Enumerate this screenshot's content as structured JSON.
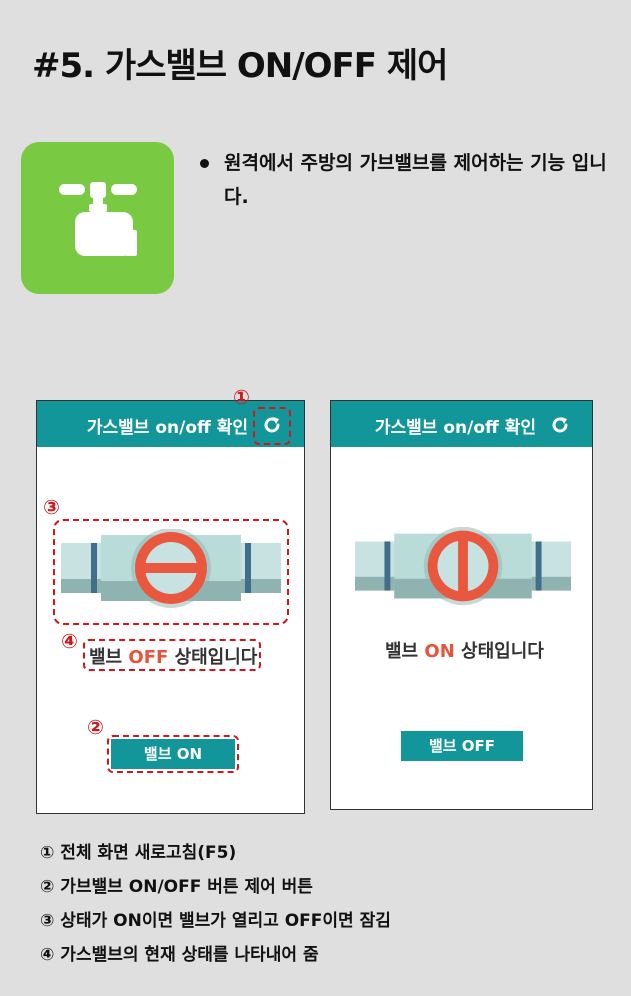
{
  "title": "#5. 가스밸브 ON/OFF 제어",
  "description": "원격에서 주방의 가브밸브를 제어하는 기능 입니다.",
  "colors": {
    "accent": "#13969a",
    "icon_bg": "#7ac943",
    "highlight": "#d4161b",
    "state_text": "#e8533a"
  },
  "left_screen": {
    "header_title": "가스밸브 on/off 확인",
    "refresh_icon": "refresh-icon",
    "status_prefix": "밸브 ",
    "status_state": "OFF",
    "status_suffix": " 상태입니다",
    "button_label": "밸브 ON"
  },
  "right_screen": {
    "header_title": "가스밸브 on/off 확인",
    "refresh_icon": "refresh-icon",
    "status_prefix": "밸브 ",
    "status_state": "ON",
    "status_suffix": " 상태입니다",
    "button_label": "밸브 OFF"
  },
  "markers": {
    "m1": "①",
    "m2": "②",
    "m3": "③",
    "m4": "④"
  },
  "legend": [
    "① 전체 화면 새로고침(F5)",
    "② 가브밸브 ON/OFF 버튼 제어 버튼",
    "③ 상태가 ON이면 밸브가 열리고 OFF이면 잠김",
    "④ 가스밸브의 현재 상태를 나타내어 줌"
  ]
}
